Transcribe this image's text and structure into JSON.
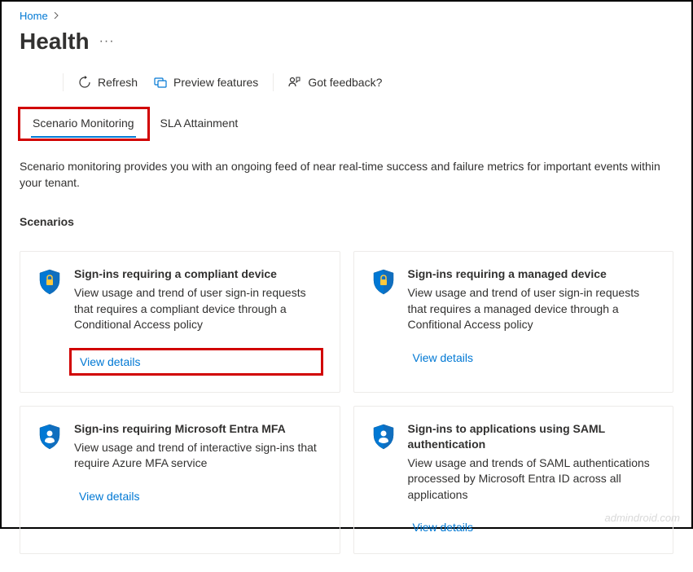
{
  "breadcrumb": {
    "home": "Home"
  },
  "page": {
    "title": "Health",
    "description": "Scenario monitoring provides you with an ongoing feed of near real-time success and failure metrics for important events within your tenant."
  },
  "toolbar": {
    "refresh": "Refresh",
    "preview": "Preview features",
    "feedback": "Got feedback?"
  },
  "tabs": {
    "scenario_monitoring": "Scenario Monitoring",
    "sla_attainment": "SLA Attainment"
  },
  "scenarios": {
    "heading": "Scenarios",
    "cards": [
      {
        "icon": "shield-lock",
        "title": "Sign-ins requiring a compliant device",
        "desc": "View usage and trend of user sign-in requests that requires a compliant device through a Conditional Access policy",
        "link": "View details"
      },
      {
        "icon": "shield-lock",
        "title": "Sign-ins requiring a managed device",
        "desc": "View usage and trend of user sign-in requests that requires a managed device through a Confitional Access policy",
        "link": "View details"
      },
      {
        "icon": "shield-user",
        "title": "Sign-ins requiring Microsoft Entra MFA",
        "desc": "View usage and trend of interactive sign-ins that require Azure MFA service",
        "link": "View details"
      },
      {
        "icon": "shield-user",
        "title": "Sign-ins to applications using SAML authentication",
        "desc": "View usage and trends of SAML authentications processed by Microsoft Entra ID across all applications",
        "link": "View details"
      }
    ]
  },
  "watermark": "admindroid.com"
}
